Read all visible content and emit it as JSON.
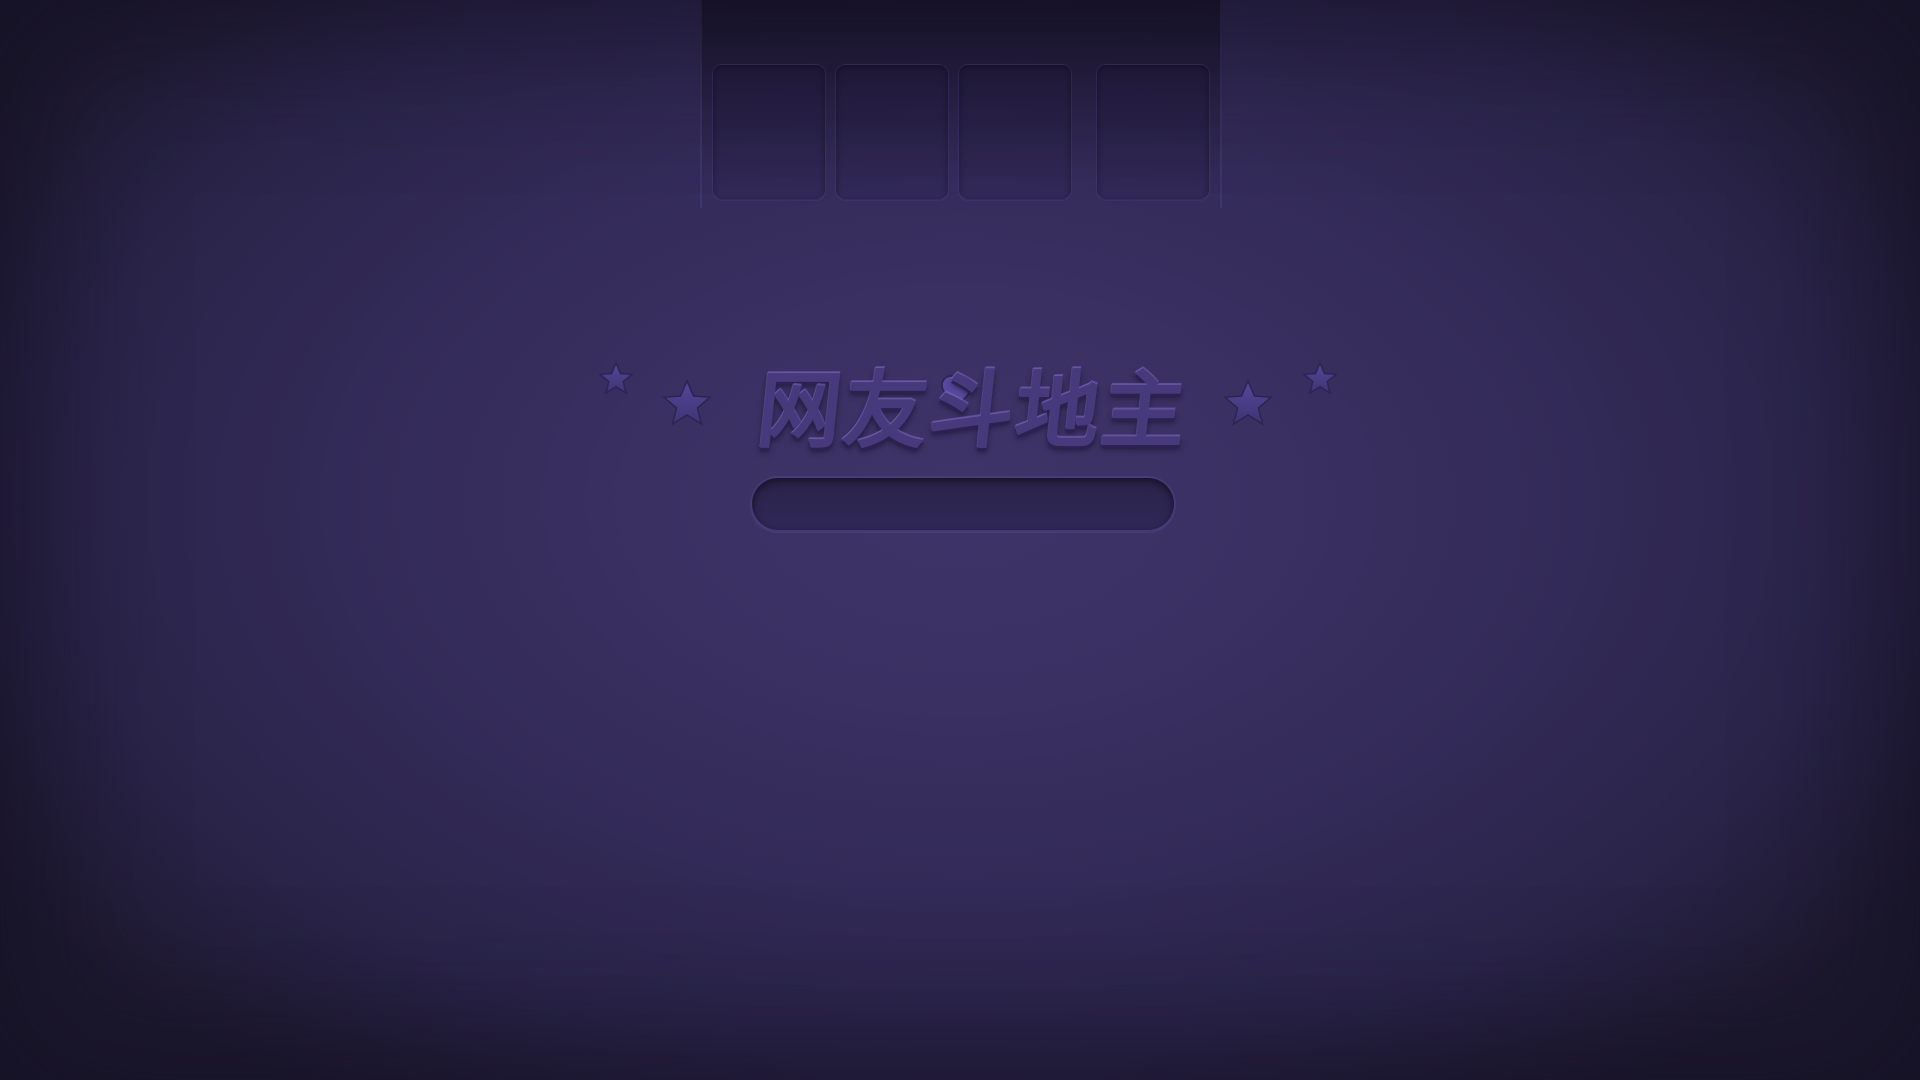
{
  "logo": {
    "title": "网友斗地主",
    "star_icon": "star-icon",
    "heart_icon": "heart-icon",
    "color": "#46397c"
  },
  "card_panel": {
    "slot_count": 4
  },
  "loading": {
    "progress": 0
  },
  "colors": {
    "background": "#3a3062",
    "background_edge": "#1d192f",
    "emboss": "#46397c"
  }
}
